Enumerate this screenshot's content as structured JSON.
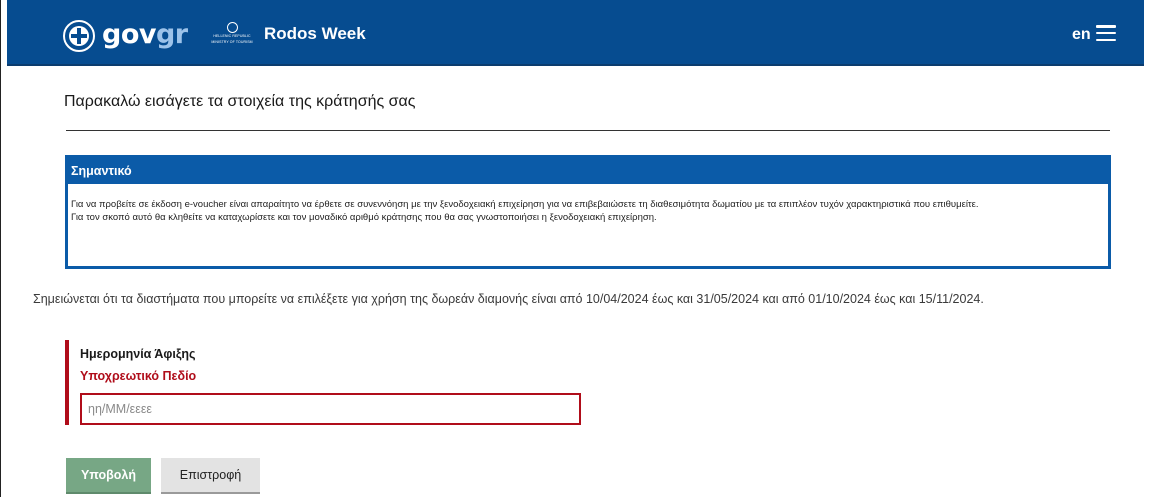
{
  "header": {
    "logo_text_main": "gov",
    "logo_text_accent": "gr",
    "ministry_lines": [
      "HELLENIC REPUBLIC",
      "MINISTRY OF TOURISM"
    ],
    "app_title": "Rodos Week",
    "language": "en",
    "colors": {
      "bar": "#064c90",
      "accent": "#9dc3ea"
    }
  },
  "main": {
    "title": "Παρακαλώ εισάγετε τα στοιχεία της κράτησής σας",
    "notice": {
      "heading": "Σημαντικό",
      "paragraph_1": "Για να προβείτε σε έκδοση e-voucher είναι απαραίτητο να έρθετε σε συνεννόηση με την ξενοδοχειακή επιχείρηση για να επιβεβαιώσετε τη διαθεσιμότητα δωματίου με τα επιπλέον τυχόν χαρακτηριστικά που επιθυμείτε.",
      "paragraph_2": "Για τον σκοπό αυτό θα κληθείτε να καταχωρίσετε και τον μοναδικό αριθμό κράτησης που θα σας γνωστοποιήσει η ξενοδοχειακή επιχείρηση."
    },
    "info_note": "Σημειώνεται ότι τα διαστήματα που μπορείτε να επιλέξετε για χρήση της δωρεάν διαμονής είναι από 10/04/2024 έως και 31/05/2024 και από 01/10/2024 έως και 15/11/2024.",
    "arrival_field": {
      "label": "Ημερομηνία Άφιξης",
      "error": "Υποχρεωτικό Πεδίο",
      "value": "",
      "placeholder": "ηη/ΜΜ/εεεε"
    },
    "buttons": {
      "submit_label": "Υποβολή",
      "back_label": "Επιστροφή"
    },
    "colors": {
      "notice": "#0b5ba8",
      "error": "#b00d1a",
      "submit": "#77a785"
    }
  }
}
